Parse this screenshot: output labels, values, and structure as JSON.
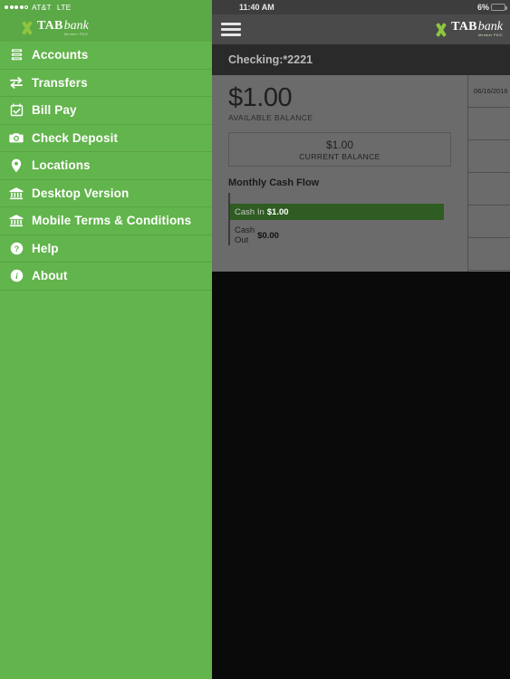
{
  "status_bar_left": {
    "signal_dots_filled": 4,
    "signal_dots_total": 5,
    "carrier": "AT&T",
    "network": "LTE"
  },
  "status_bar_right": {
    "time": "11:40 AM",
    "battery_percent": "6%",
    "battery_level": 6
  },
  "brand": {
    "name_bold": "TAB",
    "name_italic": "bank",
    "member_fdic": "Member FDIC",
    "logo_icon": "tab-bank-x-logo",
    "accent_color": "#8dc63f"
  },
  "sidebar": {
    "background_color": "#62b44c",
    "items": [
      {
        "label": "Accounts",
        "icon": "accounts-stack-icon"
      },
      {
        "label": "Transfers",
        "icon": "transfers-arrows-icon"
      },
      {
        "label": "Bill Pay",
        "icon": "calendar-check-icon"
      },
      {
        "label": "Check Deposit",
        "icon": "camera-icon"
      },
      {
        "label": "Locations",
        "icon": "map-pin-icon"
      },
      {
        "label": "Desktop Version",
        "icon": "bank-building-icon"
      },
      {
        "label": "Mobile Terms & Conditions",
        "icon": "bank-building-icon"
      },
      {
        "label": "Help",
        "icon": "question-circle-icon"
      },
      {
        "label": "About",
        "icon": "info-circle-icon"
      }
    ]
  },
  "navbar": {
    "menu_icon": "hamburger-menu-icon"
  },
  "account_card": {
    "title": "Checking:*2221",
    "available_balance_amount": "$1.00",
    "available_balance_label": "AVAILABLE BALANCE",
    "current_balance_amount": "$1.00",
    "current_balance_label": "CURRENT BALANCE",
    "cash_flow_title": "Monthly Cash Flow",
    "cash_in_label": "Cash In",
    "cash_in_value": "$1.00",
    "cash_out_label": "Cash Out",
    "cash_out_value": "$0.00",
    "bar_color": "#2e5c22"
  },
  "transactions": {
    "rows": [
      {
        "date": "06/16/2016"
      },
      {
        "date": ""
      },
      {
        "date": ""
      },
      {
        "date": ""
      },
      {
        "date": ""
      },
      {
        "date": ""
      }
    ]
  }
}
